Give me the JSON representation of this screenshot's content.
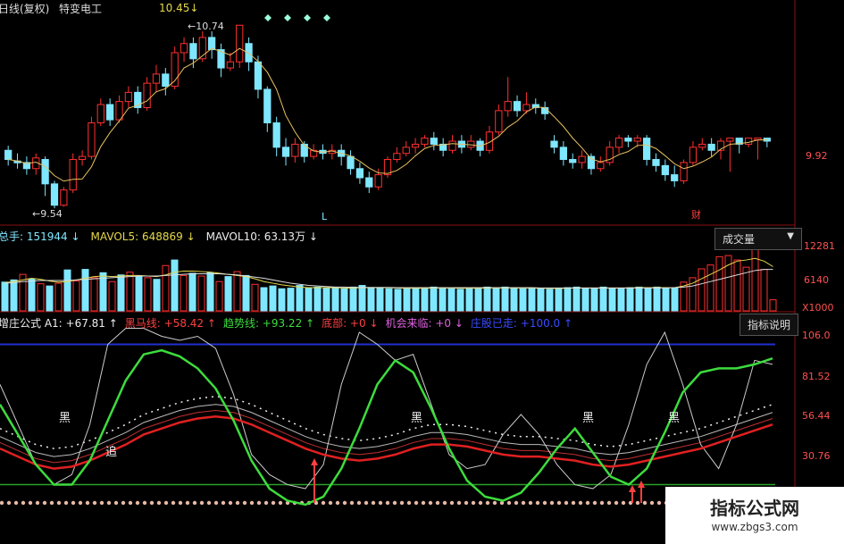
{
  "header": {
    "period_label": "日线(复权)",
    "stock_name": "特变电工",
    "price_marker": "10.45",
    "price_marker_arrow": "↓"
  },
  "price_panel": {
    "high_label": "10.74",
    "low_label": "9.54",
    "right_axis_label": "9.92",
    "mark_L": "L",
    "mark_cai": "财"
  },
  "volume_panel": {
    "items": [
      {
        "label": "总手: ",
        "value": "151944",
        "arrow": "↓",
        "color": "#7fe7ff"
      },
      {
        "label": "MAVOL5: ",
        "value": "648869",
        "arrow": "↓",
        "color": "#e6d84a"
      },
      {
        "label": "MAVOL10: ",
        "value": "63.13万",
        "arrow": "↓",
        "color": "#eeeeee"
      }
    ],
    "button_label": "成交量",
    "axis": [
      "12281",
      "6140",
      "X1000"
    ]
  },
  "indicator_panel": {
    "items": [
      {
        "label": "增庄公式 A1: ",
        "value": "+67.81",
        "arrow": "↑",
        "color": "#eeeeee"
      },
      {
        "label": "黑马线: ",
        "value": "+58.42",
        "arrow": "↑",
        "color": "#ff4040"
      },
      {
        "label": "趋势线: ",
        "value": "+93.22",
        "arrow": "↑",
        "color": "#3ddc3d"
      },
      {
        "label": "底部: ",
        "value": "+0",
        "arrow": "↓",
        "color": "#ff4040"
      },
      {
        "label": "机会来临: ",
        "value": "+0",
        "arrow": "↓",
        "color": "#e060e0"
      },
      {
        "label": "庄股已走: ",
        "value": "+100.0",
        "arrow": "↑",
        "color": "#3a4bff"
      }
    ],
    "button_label": "指标说明",
    "axis": [
      "106.0",
      "81.52",
      "56.44",
      "30.76"
    ],
    "labels": [
      "黑",
      "黑",
      "黑",
      "黑",
      "追"
    ]
  },
  "watermark": {
    "title": "指标公式网",
    "url": "www.zbgs3.com"
  },
  "colors": {
    "up": "#ff3030",
    "down": "#7fe7ff",
    "ma": "#e8c060",
    "trend": "#3ddc3d",
    "black_horse": "#e02020"
  },
  "chart_data": [
    {
      "type": "candlestick",
      "title": "",
      "candles": [
        [
          9.92,
          9.86,
          9.95,
          9.82
        ],
        [
          9.85,
          9.84,
          9.9,
          9.8
        ],
        [
          9.84,
          9.8,
          9.88,
          9.76
        ],
        [
          9.8,
          9.87,
          9.9,
          9.76
        ],
        [
          9.86,
          9.7,
          9.88,
          9.62
        ],
        [
          9.7,
          9.56,
          9.72,
          9.54
        ],
        [
          9.56,
          9.66,
          9.68,
          9.55
        ],
        [
          9.66,
          9.86,
          9.9,
          9.64
        ],
        [
          9.86,
          9.88,
          9.92,
          9.82
        ],
        [
          9.88,
          10.1,
          10.14,
          9.86
        ],
        [
          10.1,
          10.22,
          10.26,
          10.08
        ],
        [
          10.22,
          10.12,
          10.26,
          10.08
        ],
        [
          10.12,
          10.24,
          10.28,
          10.1
        ],
        [
          10.24,
          10.3,
          10.34,
          10.2
        ],
        [
          10.3,
          10.2,
          10.34,
          10.16
        ],
        [
          10.2,
          10.36,
          10.4,
          10.18
        ],
        [
          10.36,
          10.42,
          10.48,
          10.3
        ],
        [
          10.42,
          10.34,
          10.46,
          10.28
        ],
        [
          10.34,
          10.56,
          10.6,
          10.32
        ],
        [
          10.56,
          10.62,
          10.66,
          10.5
        ],
        [
          10.62,
          10.52,
          10.66,
          10.46
        ],
        [
          10.52,
          10.66,
          10.7,
          10.5
        ],
        [
          10.66,
          10.58,
          10.7,
          10.52
        ],
        [
          10.58,
          10.46,
          10.62,
          10.4
        ],
        [
          10.46,
          10.5,
          10.56,
          10.44
        ],
        [
          10.5,
          10.74,
          10.74,
          10.46
        ],
        [
          10.62,
          10.5,
          10.66,
          10.44
        ],
        [
          10.5,
          10.32,
          10.54,
          10.26
        ],
        [
          10.32,
          10.1,
          10.34,
          10.04
        ],
        [
          10.1,
          9.94,
          10.14,
          9.88
        ],
        [
          9.94,
          9.88,
          10.0,
          9.82
        ],
        [
          9.88,
          9.96,
          10.0,
          9.84
        ],
        [
          9.96,
          9.88,
          9.98,
          9.84
        ],
        [
          9.88,
          9.92,
          9.96,
          9.86
        ],
        [
          9.92,
          9.9,
          9.96,
          9.86
        ],
        [
          9.9,
          9.92,
          9.96,
          9.86
        ],
        [
          9.92,
          9.88,
          9.96,
          9.82
        ],
        [
          9.88,
          9.8,
          9.92,
          9.76
        ],
        [
          9.8,
          9.74,
          9.84,
          9.7
        ],
        [
          9.74,
          9.68,
          9.78,
          9.64
        ],
        [
          9.68,
          9.76,
          9.8,
          9.66
        ],
        [
          9.76,
          9.86,
          9.88,
          9.74
        ],
        [
          9.86,
          9.9,
          9.94,
          9.84
        ],
        [
          9.9,
          9.94,
          9.98,
          9.88
        ],
        [
          9.94,
          9.96,
          10.0,
          9.9
        ],
        [
          9.96,
          10.0,
          10.02,
          9.94
        ],
        [
          10.0,
          9.96,
          10.04,
          9.92
        ],
        [
          9.96,
          9.92,
          10.0,
          9.88
        ],
        [
          9.92,
          9.98,
          10.02,
          9.9
        ],
        [
          9.98,
          9.94,
          10.02,
          9.9
        ],
        [
          9.94,
          9.98,
          10.02,
          9.92
        ],
        [
          9.98,
          9.92,
          10.0,
          9.88
        ],
        [
          9.92,
          10.04,
          10.08,
          9.9
        ],
        [
          10.04,
          10.18,
          10.22,
          10.02
        ],
        [
          10.18,
          10.24,
          10.4,
          10.14
        ],
        [
          10.24,
          10.18,
          10.28,
          10.14
        ],
        [
          10.18,
          10.22,
          10.3,
          10.16
        ],
        [
          10.22,
          10.2,
          10.26,
          10.16
        ],
        [
          10.2,
          10.16,
          10.24,
          10.12
        ],
        [
          9.98,
          9.94,
          10.02,
          9.9
        ],
        [
          9.94,
          9.86,
          9.98,
          9.82
        ],
        [
          9.86,
          9.84,
          9.9,
          9.8
        ],
        [
          9.84,
          9.88,
          9.92,
          9.8
        ],
        [
          9.88,
          9.8,
          9.9,
          9.76
        ],
        [
          9.8,
          9.84,
          9.88,
          9.78
        ],
        [
          9.84,
          9.94,
          9.98,
          9.82
        ],
        [
          9.94,
          10.0,
          10.02,
          9.9
        ],
        [
          10.0,
          9.98,
          10.02,
          9.94
        ],
        [
          9.98,
          10.0,
          10.02,
          9.94
        ],
        [
          10.0,
          9.86,
          10.02,
          9.82
        ],
        [
          9.86,
          9.82,
          9.9,
          9.78
        ],
        [
          9.82,
          9.76,
          9.86,
          9.72
        ],
        [
          9.76,
          9.72,
          9.82,
          9.68
        ],
        [
          9.72,
          9.84,
          9.86,
          9.7
        ],
        [
          9.84,
          9.94,
          9.98,
          9.82
        ],
        [
          9.94,
          9.96,
          10.0,
          9.92
        ],
        [
          9.96,
          9.92,
          10.0,
          9.88
        ],
        [
          9.92,
          9.98,
          10.0,
          9.86
        ],
        [
          9.98,
          10.0,
          10.0,
          9.78
        ],
        [
          10.0,
          9.96,
          10.0,
          9.9
        ],
        [
          9.96,
          10.0,
          10.0,
          9.94
        ],
        [
          10.0,
          10.0,
          10.0,
          9.86
        ],
        [
          10.0,
          9.98,
          10.0,
          9.94
        ]
      ]
    },
    {
      "type": "bar",
      "title": "成交量",
      "ylim": [
        0,
        12281
      ],
      "values": [
        5200,
        5600,
        6600,
        5800,
        4900,
        4500,
        5000,
        7400,
        5400,
        7500,
        6000,
        6900,
        5300,
        6500,
        7000,
        6200,
        6000,
        5700,
        8200,
        9200,
        6400,
        6800,
        6300,
        6900,
        5300,
        6200,
        7100,
        6400,
        4800,
        4200,
        4500,
        4000,
        4100,
        4600,
        4100,
        4300,
        4100,
        4100,
        4000,
        4300,
        4600,
        4200,
        4100,
        4000,
        3900,
        4000,
        4200,
        4100,
        4300,
        4200,
        4000,
        3900,
        4200,
        4000,
        4300,
        4100,
        4300,
        4100,
        4000,
        4100,
        4000,
        3900,
        4100,
        4200,
        4300,
        4100,
        4000,
        4300,
        4100,
        4000,
        4200,
        4300,
        4100,
        4300,
        4100,
        4100,
        5200,
        6000,
        7600,
        8300,
        9800,
        10000,
        9200,
        7900,
        11800,
        7500,
        2000
      ],
      "ma5": [
        5100,
        5300,
        5600,
        5900,
        5700,
        5400,
        5200,
        5300,
        5600,
        5900,
        6200,
        6300,
        6200,
        6300,
        6400,
        6400,
        6300,
        6200,
        6500,
        7000,
        7200,
        7200,
        7100,
        7000,
        6800,
        6600,
        6400,
        6200,
        5800,
        5300,
        5000,
        4700,
        4500,
        4300,
        4200,
        4200,
        4200,
        4200,
        4150,
        4150,
        4200,
        4200,
        4200,
        4200,
        4150,
        4100,
        4100,
        4100,
        4150,
        4150,
        4150,
        4100,
        4100,
        4100,
        4150,
        4150,
        4150,
        4150,
        4150,
        4150,
        4100,
        4050,
        4050,
        4100,
        4150,
        4150,
        4150,
        4150,
        4150,
        4150,
        4150,
        4200,
        4200,
        4200,
        4200,
        4200,
        4500,
        5000,
        5800,
        6600,
        7400,
        8300,
        9000,
        9200,
        9500,
        9000,
        8000
      ],
      "ma10": [
        5000,
        5100,
        5300,
        5400,
        5500,
        5500,
        5500,
        5500,
        5600,
        5700,
        5800,
        5900,
        6000,
        6100,
        6200,
        6300,
        6300,
        6300,
        6400,
        6500,
        6600,
        6700,
        6700,
        6700,
        6700,
        6600,
        6500,
        6300,
        6100,
        5900,
        5600,
        5300,
        5000,
        4800,
        4600,
        4500,
        4400,
        4300,
        4300,
        4250,
        4250,
        4250,
        4250,
        4250,
        4200,
        4200,
        4200,
        4200,
        4200,
        4200,
        4200,
        4200,
        4200,
        4200,
        4200,
        4200,
        4200,
        4200,
        4200,
        4200,
        4150,
        4150,
        4150,
        4150,
        4150,
        4150,
        4150,
        4150,
        4150,
        4150,
        4150,
        4150,
        4150,
        4150,
        4150,
        4200,
        4300,
        4500,
        4900,
        5300,
        5700,
        6100,
        6500,
        6900,
        7300,
        7500,
        7500
      ]
    },
    {
      "type": "line",
      "title": "增庄公式",
      "ylim": [
        20,
        106
      ],
      "x": [
        0,
        1,
        2,
        3,
        4,
        5,
        6,
        7,
        8,
        9,
        10,
        11,
        12,
        13,
        14,
        15,
        16,
        17,
        18,
        19,
        20,
        21,
        22,
        23,
        24,
        25,
        26,
        27,
        28,
        29,
        30,
        31,
        32,
        33,
        34,
        35,
        36,
        37,
        38,
        39,
        40,
        41,
        42,
        43
      ],
      "series": [
        {
          "name": "A1",
          "color": "#cccccc",
          "values": [
            80,
            60,
            40,
            30,
            35,
            60,
            100,
            108,
            108,
            104,
            102,
            104,
            98,
            75,
            45,
            35,
            30,
            28,
            40,
            80,
            106,
            100,
            92,
            95,
            70,
            45,
            38,
            40,
            55,
            65,
            55,
            40,
            30,
            28,
            35,
            60,
            90,
            106,
            80,
            50,
            38,
            60,
            92,
            90
          ]
        },
        {
          "name": "黑马线",
          "color": "#e02020",
          "values": [
            48,
            44,
            40,
            38,
            39,
            42,
            46,
            50,
            55,
            58,
            61,
            63,
            64,
            63,
            60,
            56,
            52,
            48,
            45,
            43,
            42,
            43,
            45,
            48,
            50,
            50,
            49,
            47,
            45,
            44,
            44,
            43,
            42,
            40,
            39,
            40,
            42,
            44,
            46,
            48,
            51,
            54,
            57,
            60
          ]
        },
        {
          "name": "趋势线",
          "color": "#3ddc3d",
          "values": [
            70,
            55,
            40,
            30,
            30,
            42,
            62,
            82,
            95,
            97,
            94,
            88,
            78,
            62,
            42,
            28,
            22,
            20,
            24,
            38,
            58,
            80,
            92,
            86,
            68,
            48,
            32,
            24,
            22,
            26,
            36,
            48,
            58,
            46,
            34,
            30,
            38,
            56,
            76,
            86,
            88,
            88,
            90,
            93
          ]
        }
      ]
    }
  ]
}
